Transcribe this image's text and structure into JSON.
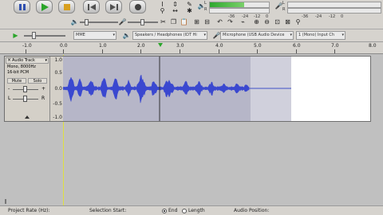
{
  "toolbar": {
    "meter_scale_playback": [
      "-36",
      "-24",
      "-12",
      "0"
    ],
    "meter_scale_record": [
      "-36",
      "-24",
      "-12",
      "0"
    ],
    "meter_labels": {
      "l": "L",
      "r": "R"
    }
  },
  "devices": {
    "host": "MME",
    "playback": "Speakers / Headphones (IDT Hi",
    "recording": "Microphone (USB Audio Device",
    "channels": "1 (Mono) Input Ch"
  },
  "ruler": {
    "labels": [
      "-1.0",
      "0.0",
      "1.0",
      "2.0",
      "3.0",
      "4.0",
      "5.0",
      "6.0",
      "7.0",
      "8.0"
    ]
  },
  "track": {
    "name": "Audio Track",
    "info_line1": "Mono, 8000Hz",
    "info_line2": "16-bit PCM",
    "mute_label": "Mute",
    "solo_label": "Solo",
    "gain_minus": "-",
    "gain_plus": "+",
    "pan_l": "L",
    "pan_r": "R",
    "scale": [
      "1.0",
      "0.5",
      "0.0",
      "-0.5",
      "-1.0"
    ]
  },
  "status": {
    "project_rate_label": "Project Rate (Hz):",
    "selection_start_label": "Selection Start:",
    "end_label": "End",
    "length_label": "Length",
    "audio_position_label": "Audio Position:"
  }
}
